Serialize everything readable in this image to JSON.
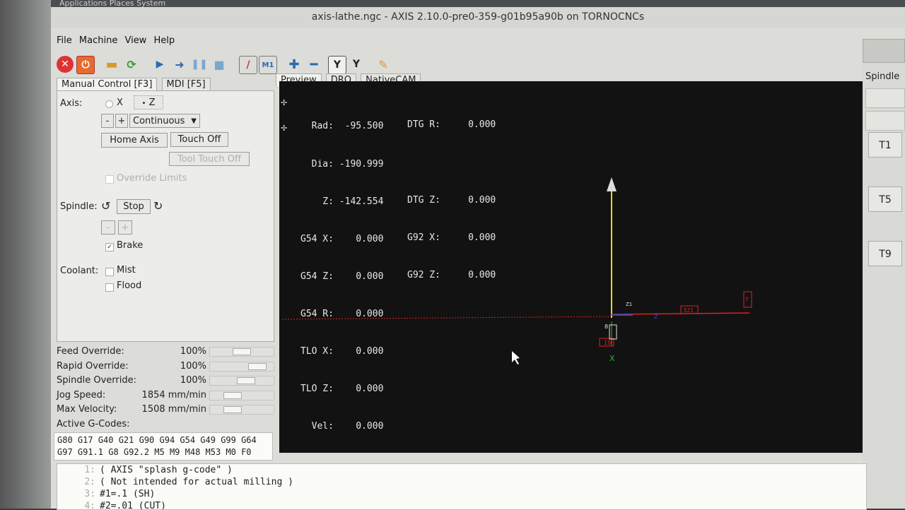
{
  "topbar": {
    "text": "Applications  Places  System"
  },
  "title": "axis-lathe.ngc - AXIS 2.10.0-pre0-359-g01b95a90b on TORNOCNCs",
  "menu": [
    "File",
    "Machine",
    "View",
    "Help"
  ],
  "toolbar": {
    "icons": [
      "estop-icon",
      "power-icon",
      "open-file-icon",
      "reload-icon",
      "run-icon",
      "step-icon",
      "pause-icon",
      "stop-icon",
      "block-delete-icon",
      "optional-stop-icon",
      "zoom-in-icon",
      "zoom-out-icon",
      "view-y-icon",
      "view-y2-icon",
      "clear-plot-icon"
    ],
    "view_y_label": "Y",
    "view_y2_label": "Y"
  },
  "left_tabs": [
    "Manual Control [F3]",
    "MDI [F5]"
  ],
  "manual": {
    "axis_label": "Axis:",
    "axis_x": "X",
    "axis_z": "Z",
    "minus": "-",
    "plus": "+",
    "jog_mode": "Continuous",
    "home_axis": "Home Axis",
    "touch_off": "Touch Off",
    "tool_touch_off": "Tool Touch Off",
    "override_limits": "Override Limits",
    "spindle_label": "Spindle:",
    "spindle_stop": "Stop",
    "spindle_minus": "-",
    "spindle_plus": "+",
    "brake": "Brake",
    "brake_checked": "✓",
    "coolant_label": "Coolant:",
    "mist": "Mist",
    "flood": "Flood"
  },
  "overrides": [
    {
      "name": "Feed Override:",
      "value": "100%",
      "level": 0.5
    },
    {
      "name": "Rapid Override:",
      "value": "100%",
      "level": 0.85
    },
    {
      "name": "Spindle Override:",
      "value": "100%",
      "level": 0.6
    },
    {
      "name": "Jog Speed:",
      "value": "1854 mm/min",
      "level": 0.3
    },
    {
      "name": "Max Velocity:",
      "value": "1508 mm/min",
      "level": 0.3
    }
  ],
  "active_gcodes_label": "Active G-Codes:",
  "active_gcodes": [
    "G80 G17 G40 G21 G90 G94 G54 G49 G99 G64",
    "G97 G91.1 G8 G92.2 M5 M9 M48 M53 M0 F0"
  ],
  "right_tabs": [
    "Preview",
    "DRO",
    "NativeCAM"
  ],
  "dro": {
    "left": [
      "  Rad:  -95.500",
      "  Dia: -190.999",
      "    Z: -142.554",
      "G54 X:    0.000",
      "G54 Z:    0.000",
      "G54 R:    0.000",
      "TLO X:    0.000",
      "TLO Z:    0.000",
      "  Vel:    0.000"
    ],
    "right": [
      "DTG R:     0.000",
      "",
      "DTG Z:     0.000",
      "G92 X:     0.000",
      "G92 Z:     0.000"
    ]
  },
  "plot_labels": {
    "x_axis": "X",
    "tag_321": "321",
    "tag_19": "19",
    "tag_t": "T",
    "tick_8": "8",
    "tick_z": "Z",
    "tick_z2": "Z1"
  },
  "spindle_panel_label": "Spindle",
  "tools": [
    "T1",
    "T5",
    "T9"
  ],
  "code_lines": [
    {
      "n": "1:",
      "text": "( AXIS \"splash g-code\" )"
    },
    {
      "n": "2:",
      "text": "( Not intended for actual milling )"
    },
    {
      "n": "3:",
      "text": "#1=.1 (SH)"
    },
    {
      "n": "4:",
      "text": "#2=.01 (CUT)"
    }
  ],
  "colors": {
    "background": "#121212",
    "dro_text": "#e8e8e8",
    "z_axis": "#e6d820",
    "rapid": "#e02020",
    "x_axis": "#22bb33",
    "z_mark": "#2a4bd0"
  }
}
